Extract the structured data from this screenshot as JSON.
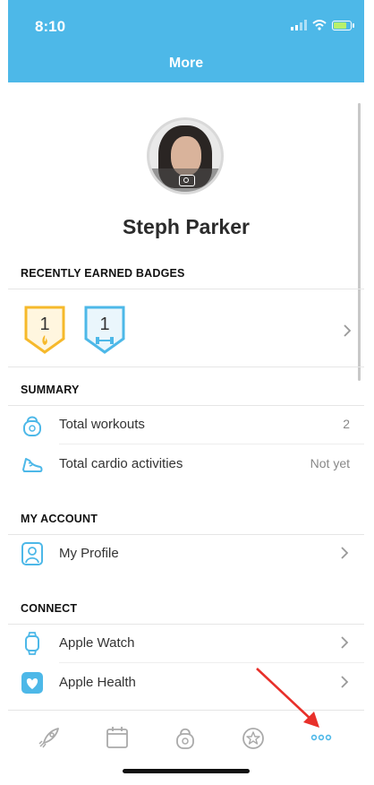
{
  "status": {
    "time": "8:10"
  },
  "header": {
    "title": "More"
  },
  "profile": {
    "name": "Steph Parker"
  },
  "badges": {
    "title": "RECENTLY EARNED BADGES",
    "items": [
      {
        "count": "1",
        "icon": "flame-icon"
      },
      {
        "count": "1",
        "icon": "dumbbell-icon"
      }
    ]
  },
  "summary": {
    "title": "SUMMARY",
    "items": [
      {
        "label": "Total workouts",
        "value": "2",
        "icon": "kettlebell-icon"
      },
      {
        "label": "Total cardio activities",
        "value": "Not yet",
        "icon": "shoe-icon"
      }
    ]
  },
  "account": {
    "title": "MY ACCOUNT",
    "items": [
      {
        "label": "My Profile",
        "icon": "profile-icon"
      }
    ]
  },
  "connect": {
    "title": "CONNECT",
    "items": [
      {
        "label": "Apple Watch",
        "icon": "watch-icon"
      },
      {
        "label": "Apple Health",
        "icon": "heart-icon"
      }
    ]
  },
  "tabbar": {
    "items": [
      "rocket-icon",
      "calendar-icon",
      "kettlebell-icon",
      "badge-star-icon",
      "more-icon"
    ],
    "active": "more-icon"
  },
  "colors": {
    "header": "#4db8e8",
    "accent": "#4db8e8",
    "badge_gold": "#f6b92b",
    "annotation_arrow": "#e8302a"
  }
}
